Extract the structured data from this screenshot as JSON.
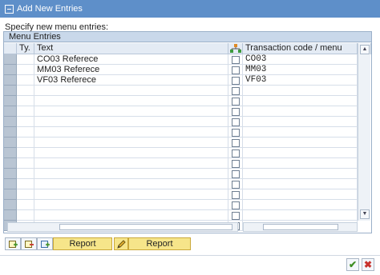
{
  "window": {
    "title": "Add New Entries"
  },
  "prompt": "Specify new menu entries:",
  "group": {
    "title": "Menu Entries"
  },
  "table": {
    "columns": {
      "type": "Ty.",
      "text": "Text",
      "code": "Transaction code / menu"
    },
    "rows": [
      {
        "text": "CO03 Referece",
        "code": "CO03"
      },
      {
        "text": "MM03 Referece",
        "code": "MM03"
      },
      {
        "text": "VF03 Referece",
        "code": "VF03"
      },
      {
        "text": "",
        "code": ""
      },
      {
        "text": "",
        "code": ""
      },
      {
        "text": "",
        "code": ""
      },
      {
        "text": "",
        "code": ""
      },
      {
        "text": "",
        "code": ""
      },
      {
        "text": "",
        "code": ""
      },
      {
        "text": "",
        "code": ""
      },
      {
        "text": "",
        "code": ""
      },
      {
        "text": "",
        "code": ""
      },
      {
        "text": "",
        "code": ""
      },
      {
        "text": "",
        "code": ""
      },
      {
        "text": "",
        "code": ""
      },
      {
        "text": "",
        "code": ""
      },
      {
        "text": "",
        "code": ""
      }
    ]
  },
  "toolbar": {
    "report_label_1": "Report",
    "report_label_2": "Report"
  },
  "icons": {
    "title": "window-icon",
    "hierarchy": "hierarchy-icon",
    "layout": "table-layout-icon",
    "insert": "insert-row-icon",
    "delete": "delete-row-icon",
    "add": "add-transaction-icon",
    "edit": "pencil-icon",
    "ok": "checkmark-icon",
    "cancel": "cancel-icon"
  },
  "colors": {
    "title_bar": "#5e8fc9",
    "group_header": "#c9d8ea",
    "report_button": "#f6e58a",
    "ok": "#3e8e22",
    "cancel": "#c8322c"
  }
}
